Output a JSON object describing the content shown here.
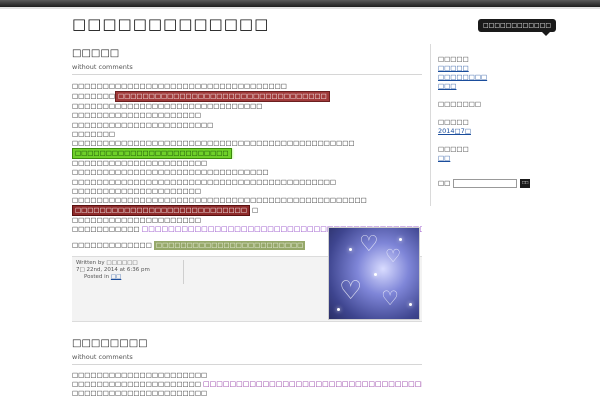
{
  "site": {
    "title": "□□□□□□□□□□□□□",
    "rss_label": "□□□□□□□□□□□□"
  },
  "post": {
    "title": "□□□□□",
    "meta": "without comments",
    "lines": {
      "l1": "□□□□□□□□□□□□□□□□□□□□□□□□□□□□□□□□□□□",
      "l2_prefix": "□□□□□□□",
      "l2_highlight": "□□□□□□□□□□□□□□□□□□□□□□□□□□□□□□□□□□",
      "l3": "□□□□□□□□□□□□□□□□□□□□□□□□□□□□□□□",
      "l4": "□□□□□□□□□□□□□□□□□□□□□",
      "l5": "□□□□□□□□□□□□□□□□□□□□□□□",
      "l6": "□□□□□□□",
      "l7": "□□□□□□□□□□□□□□□□□□□□□□□□□□□□□□□□□□□□□□□□□□□□□□",
      "l8_highlight": "□□□□□□□□□□□□□□□□□□□□□□□□□",
      "l9": "□□□□□□□□□□□□□□□□□□□□□□",
      "l10": "□□□□□□□□□□□□□□□□□□□□□□□□□□□□□□□□",
      "l11": "□□□□□□□□□□□□□□□□□□□□□□□□□□□□□□□□□□□□□□□□□□□",
      "l12": "□□□□□□□□□□□□□□□□□□□□□",
      "l13": "□□□□□□□□□□□□□□□□□□□□□□□□□□□□□□□□□□□□□□□□□□□□□□□□",
      "l14_highlight": "□□□□□□□□□□□□□□□□□□□□□□□□□□□□",
      "l14_suffix": "□",
      "l15": "□□□□□□□□□□□□□□□□□□□□□",
      "l16_prefix": "□□□□□□□□□□□",
      "l16_link": "□□□□□□□□□□□□□□□□□□□□□□□□□□□□□□□□□□□□□□□□□□□□□□□□□□□□□□□□□□□",
      "l17_prefix": "□□□□□□□□□□□□□",
      "l17_highlight": "□□□□□□□□□□□□□□□□□□□□□□□□"
    },
    "footer": {
      "written_by_prefix": "Written by",
      "author": "□□□□□□",
      "date": "7□ 22nd, 2014 at 6:36 pm",
      "posted_in_prefix": "Posted in",
      "category": "□□"
    }
  },
  "second_post": {
    "title": "□□□□□□□□",
    "meta": "without comments",
    "lines": {
      "l1": "□□□□□□□□□□□□□□□□□□□□□□",
      "l2_prefix": "□□□□□□□□□□□□□□□□□□□□□",
      "l2_link": "□□□□□□□□□□□□□□□□□□□□□□□□□□□□□□□□□□□□□□□□□□",
      "l3": "□□□□□□□□□□□□□□□□□□□□□□"
    }
  },
  "sidebar": {
    "sections": [
      {
        "heading": "□□□□□",
        "links": [
          "□□□□□",
          "□□□□□□□□",
          "□□□"
        ]
      },
      {
        "heading": "□□□□□□□",
        "links": []
      },
      {
        "heading": "□□□□□",
        "links": [
          "2014□7□"
        ]
      },
      {
        "heading": "□□□□□",
        "links": [
          "□□"
        ]
      }
    ],
    "search_label": "□□",
    "search_button": "□□",
    "search_value": ""
  },
  "colors": {
    "highlight_red": "#a03a3a",
    "highlight_green": "#6fd12a",
    "highlight_darkred": "#8e2a2a",
    "highlight_olive": "#96a86a",
    "link_purple": "#8a3ac4",
    "link_blue": "#1a4d9c"
  },
  "icons": {
    "post_image": "hearts-bokeh-image"
  }
}
